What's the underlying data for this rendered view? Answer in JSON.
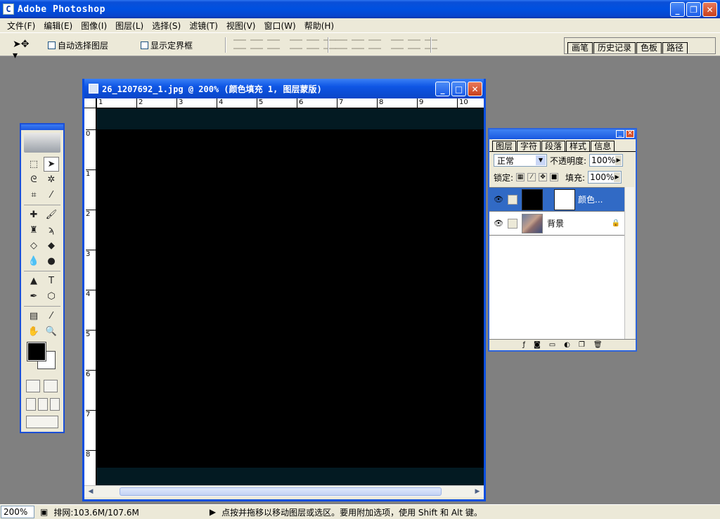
{
  "app": {
    "title": "Adobe Photoshop",
    "icon_letter": "C"
  },
  "menu": [
    "文件(F)",
    "编辑(E)",
    "图像(I)",
    "图层(L)",
    "选择(S)",
    "滤镜(T)",
    "视图(V)",
    "窗口(W)",
    "帮助(H)"
  ],
  "options": {
    "auto_select_label": "自动选择图层",
    "show_bounds_label": "显示定界框"
  },
  "well_tabs": [
    "画笔",
    "历史记录",
    "色板",
    "路径"
  ],
  "document": {
    "title": "26_1207692_1.jpg @ 200% (颜色填充 1, 图层蒙版)",
    "ruler_h": [
      "1",
      "2",
      "3",
      "4",
      "5",
      "6",
      "7",
      "8",
      "9",
      "10"
    ],
    "ruler_v": [
      "0",
      "1",
      "2",
      "3",
      "4",
      "5",
      "6",
      "7",
      "8"
    ],
    "canvas_color": "#000000",
    "canvas_edge_color": "#031a22"
  },
  "layers": {
    "tabs": [
      "图层",
      "字符",
      "段落",
      "样式",
      "信息"
    ],
    "blend_mode": "正常",
    "opacity_label": "不透明度:",
    "opacity": "100%",
    "lock_label": "锁定:",
    "fill_label": "填充:",
    "fill": "100%",
    "items": [
      {
        "name": "颜色...",
        "selected": true
      },
      {
        "name": "背景",
        "selected": false
      }
    ]
  },
  "status": {
    "zoom": "200%",
    "doc_size": "排网:103.6M/107.6M",
    "hint": "点按并拖移以移动图层或选区。要用附加选项，使用 Shift 和 Alt 键。"
  },
  "colors": {
    "accent": "#0a4fd8",
    "selected_layer": "#316ac5",
    "chrome": "#ece9d8"
  }
}
